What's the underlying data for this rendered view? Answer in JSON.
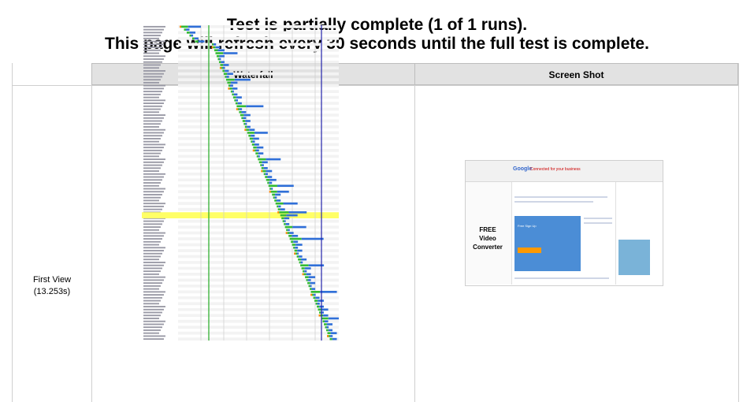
{
  "status": {
    "line1": "Test is partially complete (1 of 1 runs).",
    "line2": "This page will refresh every 30 seconds until the full test is complete."
  },
  "table": {
    "headers": {
      "waterfall": "Waterfall",
      "screenshot": "Screen Shot"
    },
    "row": {
      "label": "First View",
      "time": "(13.253s)"
    }
  },
  "screenshot": {
    "logo": "Google",
    "top_ad": "Connected for your business",
    "promo_line1": "FREE",
    "promo_line2": "Video",
    "promo_line3": "Converter",
    "button": "Free Sign Up"
  },
  "colors": {
    "bar_blue": "#2f6fd8",
    "bar_green": "#33bb33",
    "bar_orange": "#ff8800",
    "highlight": "#ffff66",
    "start_render_line": "#22aa22",
    "onload_line": "#2222aa"
  },
  "waterfall": {
    "request_count": 107,
    "highlight_row": 64
  }
}
